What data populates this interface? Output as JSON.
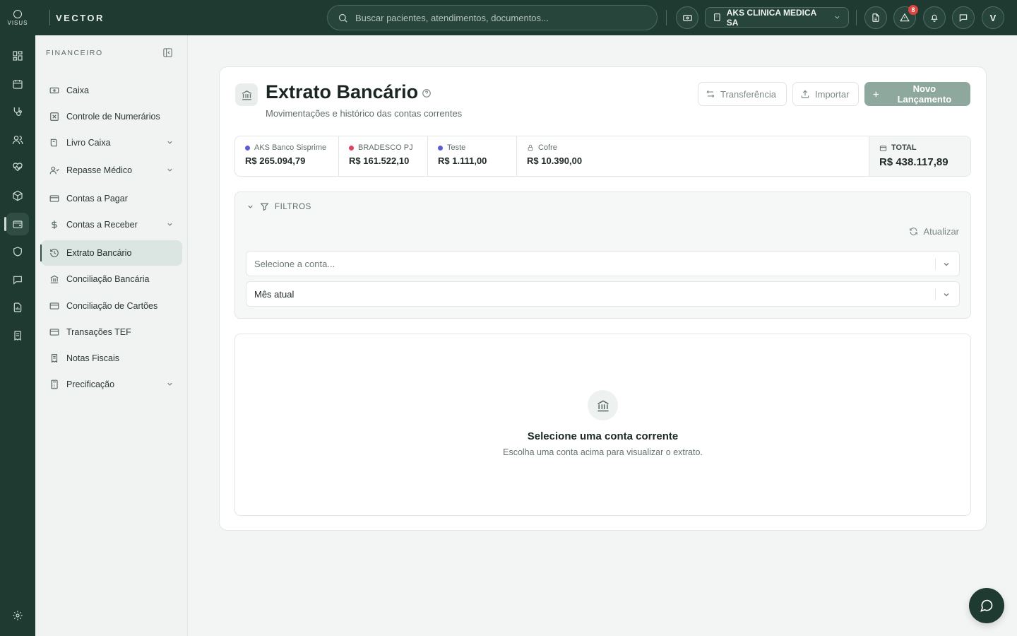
{
  "topbar": {
    "logo_text": "VISUS",
    "brand": "VECTOR",
    "search_placeholder": "Buscar pacientes, atendimentos, documentos...",
    "clinic_name": "AKS CLINICA MEDICA SA",
    "alerts_count": "8",
    "user_initial": "V"
  },
  "sidebar": {
    "section_title": "FINANCEIRO",
    "items": [
      {
        "label": "Caixa"
      },
      {
        "label": "Controle de Numerários"
      },
      {
        "label": "Livro Caixa"
      },
      {
        "label": "Repasse Médico"
      },
      {
        "label": "Contas a Pagar"
      },
      {
        "label": "Contas a Receber"
      },
      {
        "label": "Extrato Bancário"
      },
      {
        "label": "Conciliação Bancária"
      },
      {
        "label": "Conciliação de Cartões"
      },
      {
        "label": "Transações TEF"
      },
      {
        "label": "Notas Fiscais"
      },
      {
        "label": "Precificação"
      }
    ]
  },
  "page": {
    "title": "Extrato Bancário",
    "subtitle": "Movimentações e histórico das contas correntes",
    "btn_transfer": "Transferência",
    "btn_import": "Importar",
    "btn_new": "Novo Lançamento"
  },
  "accounts": [
    {
      "name": "AKS Banco Sisprime",
      "balance": "R$ 265.094,79",
      "color": "#5b5bd6"
    },
    {
      "name": "BRADESCO PJ",
      "balance": "R$ 161.522,10",
      "color": "#e0415e"
    },
    {
      "name": "Teste",
      "balance": "R$ 1.111,00",
      "color": "#5b5bd6"
    },
    {
      "name": "Cofre",
      "balance": "R$ 10.390,00"
    }
  ],
  "total": {
    "label": "TOTAL",
    "value": "R$ 438.117,89"
  },
  "filters": {
    "title": "FILTROS",
    "refresh": "Atualizar",
    "account_placeholder": "Selecione a conta...",
    "period": "Mês atual"
  },
  "empty": {
    "title": "Selecione uma conta corrente",
    "subtitle": "Escolha uma conta acima para visualizar o extrato."
  },
  "colors": {
    "brand_dark": "#1f3a31",
    "primary_button": "#8fa89e",
    "alert_badge": "#e0443f"
  }
}
